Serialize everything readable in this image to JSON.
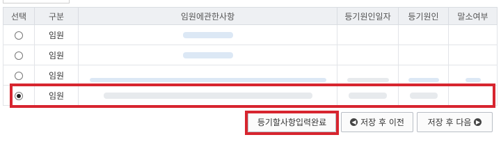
{
  "table": {
    "headers": [
      "선택",
      "구분",
      "임원에관한사항",
      "등기원인일자",
      "등기원인",
      "말소여부"
    ],
    "rows": [
      {
        "selected": false,
        "type": "임원"
      },
      {
        "selected": false,
        "type": "임원"
      },
      {
        "selected": false,
        "type": "임원"
      },
      {
        "selected": true,
        "type": "임원"
      }
    ]
  },
  "buttons": {
    "complete": "등기할사항입력완료",
    "prev": "저장 후 이전",
    "next": "저장 후 다음"
  },
  "icons": {
    "prev": "circle-arrow-left-icon",
    "next": "circle-arrow-right-icon"
  },
  "colors": {
    "highlight": "#d7252f",
    "header_bg": "#eef0f3"
  }
}
